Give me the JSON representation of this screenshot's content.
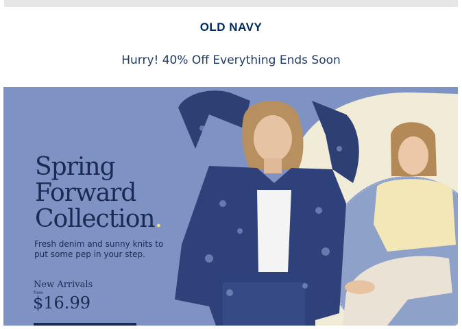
{
  "brand": {
    "logo_text": "OLD NAVY"
  },
  "promo": {
    "text": "Hurry! 40% Off Everything Ends Soon"
  },
  "hero": {
    "headline_line1": "Spring",
    "headline_line2": "Forward",
    "headline_line3": "Collection",
    "subtext": "Fresh denim and sunny knits to put some pep in your step.",
    "new_arrivals": "New Arrivals",
    "from_label": "from",
    "price": "$16.99"
  },
  "colors": {
    "brand_navy": "#002a5c",
    "hero_background": "#7e93c3",
    "hero_text": "#1b2a52",
    "accent_cream": "#f1ecd8"
  }
}
